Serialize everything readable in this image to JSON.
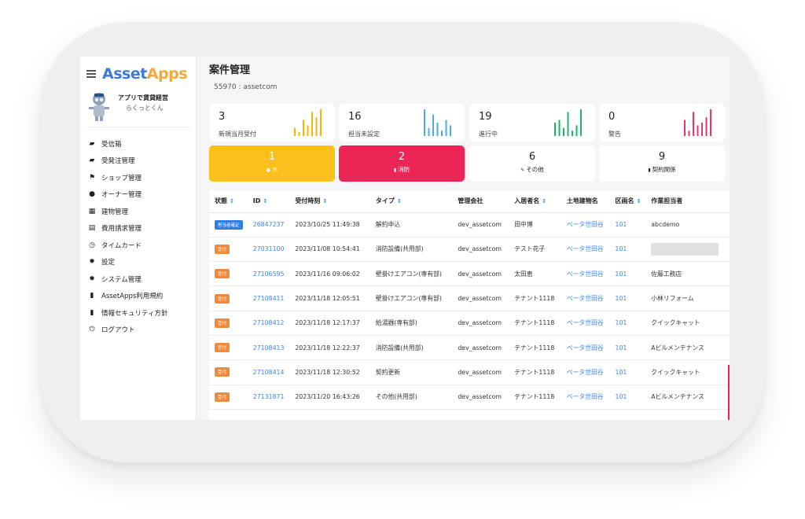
{
  "brand": {
    "prefix": "Asset",
    "suffix": "Apps"
  },
  "profile": {
    "company": "アプリで賃貸経営",
    "user": "らくっとくん"
  },
  "nav": [
    {
      "label": "受信箱",
      "icon": "inbox-icon",
      "glyph": "▰"
    },
    {
      "label": "受発注管理",
      "icon": "folder-icon",
      "glyph": "▰"
    },
    {
      "label": "ショップ管理",
      "icon": "shop-icon",
      "glyph": "⚑"
    },
    {
      "label": "オーナー管理",
      "icon": "user-icon",
      "glyph": "●"
    },
    {
      "label": "建物管理",
      "icon": "building-icon",
      "glyph": "▦"
    },
    {
      "label": "費用請求管理",
      "icon": "invoice-icon",
      "glyph": "▤"
    },
    {
      "label": "タイムカード",
      "icon": "clock-icon",
      "glyph": "◷"
    },
    {
      "label": "設定",
      "icon": "gear-icon",
      "glyph": "✹"
    },
    {
      "label": "システム管理",
      "icon": "system-gear-icon",
      "glyph": "✹"
    },
    {
      "label": "AssetApps利用規約",
      "icon": "terms-icon",
      "glyph": "▮"
    },
    {
      "label": "情報セキュリティ方針",
      "icon": "security-doc-icon",
      "glyph": "▮"
    },
    {
      "label": "ログアウト",
      "icon": "power-icon",
      "glyph": "⏻"
    }
  ],
  "page": {
    "title": "案件管理",
    "subtitle": "55970 : assetcom"
  },
  "stats": [
    {
      "value": "3",
      "label": "新規当月受付",
      "color": "#f7b500",
      "bars": [
        0.3,
        0.15,
        0.6,
        0.4,
        0.9,
        0.7,
        1.0
      ]
    },
    {
      "value": "16",
      "label": "担当未設定",
      "color": "#4fa8e8",
      "bars": [
        1.0,
        0.3,
        0.8,
        0.5,
        0.2,
        0.6,
        0.4
      ]
    },
    {
      "value": "19",
      "label": "進行中",
      "color": "#21b36b",
      "bars": [
        0.5,
        0.6,
        0.3,
        0.9,
        0.2,
        0.4,
        1.0
      ]
    },
    {
      "value": "0",
      "label": "警告",
      "color": "#e6396b",
      "bars": [
        0.6,
        0.2,
        0.9,
        0.4,
        0.5,
        0.7,
        1.0
      ]
    }
  ],
  "categories": [
    {
      "value": "1",
      "label": "水",
      "glyph": "●",
      "icon": "water-drop-icon",
      "style": "yellow"
    },
    {
      "value": "2",
      "label": "消防",
      "glyph": "▮",
      "icon": "extinguisher-icon",
      "style": "red"
    },
    {
      "value": "6",
      "label": "その他",
      "glyph": "✎",
      "icon": "wrench-icon",
      "style": "white"
    },
    {
      "value": "9",
      "label": "契約関係",
      "glyph": "▮",
      "icon": "document-icon",
      "style": "white"
    }
  ],
  "table": {
    "headers": [
      {
        "label": "状態",
        "sort": true
      },
      {
        "label": "ID",
        "sort": true
      },
      {
        "label": "受付時刻",
        "sort": true
      },
      {
        "label": "タイプ",
        "sort": true
      },
      {
        "label": "管理会社",
        "sort": false
      },
      {
        "label": "入居者名",
        "sort": true
      },
      {
        "label": "土地建物名",
        "sort": false
      },
      {
        "label": "区画名",
        "sort": true
      },
      {
        "label": "作業担当者",
        "sort": false
      }
    ],
    "rows": [
      {
        "status": "担当者確定",
        "status_color": "blue",
        "id": "26847237",
        "time": "2023/10/25 11:49:38",
        "type": "解約申込",
        "company": "dev_assetcom",
        "tenant": "田中博",
        "building": "ベータ世田谷",
        "unit": "101",
        "worker": "abcdemo"
      },
      {
        "status": "受付",
        "status_color": "orange",
        "id": "27031100",
        "time": "2023/11/08 10:54:41",
        "type": "消防設備(共用部)",
        "company": "dev_assetcom",
        "tenant": "テスト花子",
        "building": "ベータ世田谷",
        "unit": "101",
        "worker": ""
      },
      {
        "status": "受付",
        "status_color": "orange",
        "id": "27106595",
        "time": "2023/11/16 09:06:02",
        "type": "壁掛けエアコン(専有部)",
        "company": "dev_assetcom",
        "tenant": "太田恵",
        "building": "ベータ世田谷",
        "unit": "101",
        "worker": "佐藤工務店"
      },
      {
        "status": "受付",
        "status_color": "orange",
        "id": "27108411",
        "time": "2023/11/18 12:05:51",
        "type": "壁掛けエアコン(専有部)",
        "company": "dev_assetcom",
        "tenant": "テナント1118",
        "building": "ベータ世田谷",
        "unit": "101",
        "worker": "小林リフォーム"
      },
      {
        "status": "受付",
        "status_color": "orange",
        "id": "27108412",
        "time": "2023/11/18 12:17:37",
        "type": "給湯器(専有部)",
        "company": "dev_assetcom",
        "tenant": "テナント1118",
        "building": "ベータ世田谷",
        "unit": "101",
        "worker": "クイックキャット"
      },
      {
        "status": "受付",
        "status_color": "orange",
        "id": "27108413",
        "time": "2023/11/18 12:22:37",
        "type": "消防設備(共用部)",
        "company": "dev_assetcom",
        "tenant": "テナント1118",
        "building": "ベータ世田谷",
        "unit": "101",
        "worker": "Aビルメンテナンス"
      },
      {
        "status": "受付",
        "status_color": "orange",
        "id": "27108414",
        "time": "2023/11/18 12:30:52",
        "type": "契約更新",
        "company": "dev_assetcom",
        "tenant": "テナント1118",
        "building": "ベータ世田谷",
        "unit": "101",
        "worker": "クイックキャット"
      },
      {
        "status": "受付",
        "status_color": "orange",
        "id": "27131871",
        "time": "2023/11/20 16:43:26",
        "type": "その他(共用部)",
        "company": "dev_assetcom",
        "tenant": "テナント1118",
        "building": "ベータ世田谷",
        "unit": "101",
        "worker": "Aビルメンテナンス"
      }
    ]
  }
}
